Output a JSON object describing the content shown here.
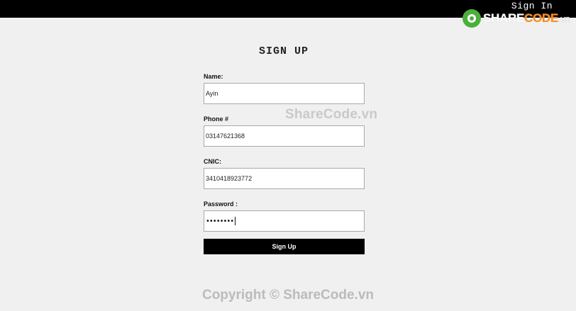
{
  "header": {
    "signin_label": "Sign In",
    "logo": {
      "part1": "SHARE",
      "part2": "CODE",
      "tld": ".vn"
    }
  },
  "page": {
    "title": "SIGN UP"
  },
  "form": {
    "name_label": "Name:",
    "name_value": "Ayin",
    "phone_label": "Phone #",
    "phone_value": "03147621368",
    "cnic_label": "CNIC:",
    "cnic_value": "3410418923772",
    "password_label": "Password :",
    "password_mask": "••••••••",
    "submit_label": "Sign Up"
  },
  "watermark": {
    "center_text": "ShareCode.vn",
    "footer_text": "Copyright © ShareCode.vn"
  },
  "colors": {
    "topbar": "#000000",
    "background": "#f0f0f0",
    "button": "#000000",
    "logo_green": "#4caf3c",
    "logo_orange": "#ff8c1a"
  }
}
